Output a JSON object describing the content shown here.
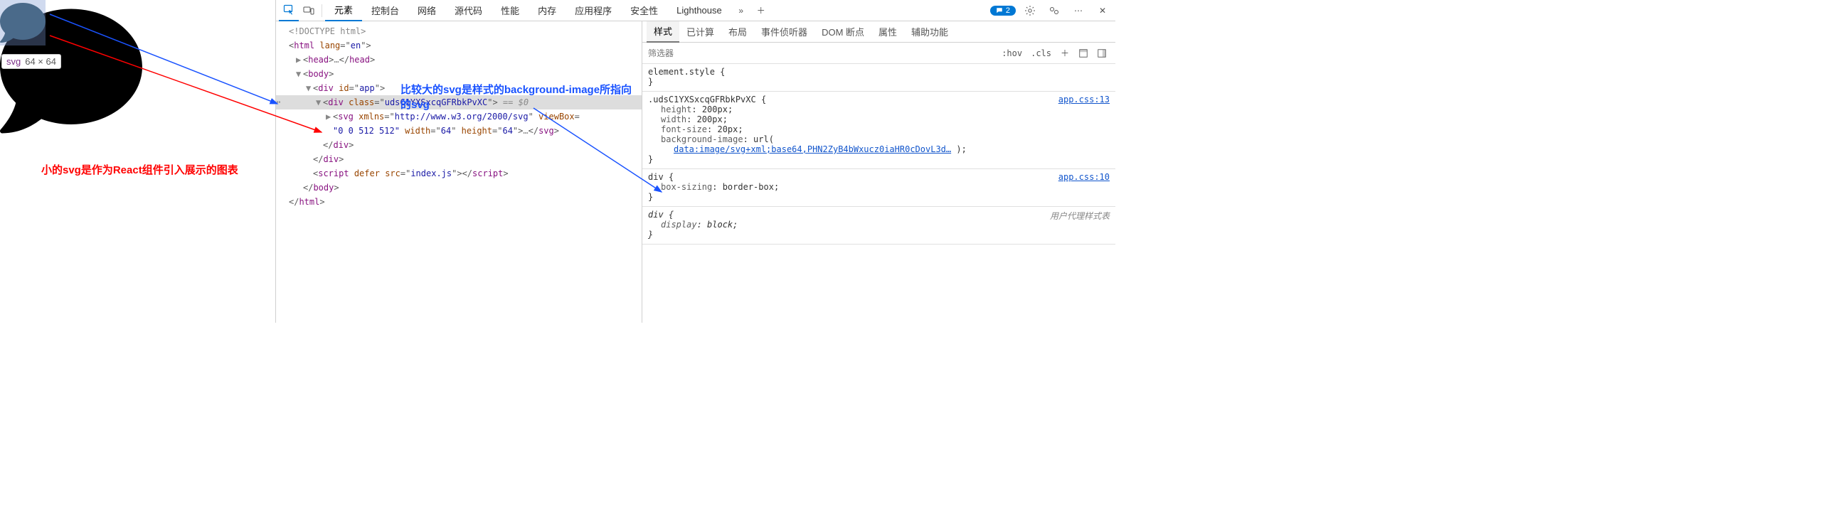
{
  "tooltip": {
    "tag": "svg",
    "dim": "64 × 64"
  },
  "annotations": {
    "red": "小的svg是作为React组件引入展示的图表",
    "blue": "比较大的svg是样式的background-image所指向的svg"
  },
  "topbar": {
    "tabs": [
      "元素",
      "控制台",
      "网络",
      "源代码",
      "性能",
      "内存",
      "应用程序",
      "安全性",
      "Lighthouse"
    ],
    "active": 0,
    "msg_count": "2"
  },
  "dom": {
    "l1": "<!DOCTYPE html>",
    "l2": {
      "tag": "html",
      "attrs": [
        [
          "lang",
          "en"
        ]
      ]
    },
    "l3": {
      "tag": "head",
      "ellipsis": true
    },
    "l4": {
      "tag": "body"
    },
    "l5": {
      "tag": "div",
      "attrs": [
        [
          "id",
          "app"
        ]
      ]
    },
    "l6": {
      "tag": "div",
      "attrs": [
        [
          "class",
          "udsC1YXSxcqGFRbkPvXC"
        ]
      ],
      "selected": true
    },
    "l7_pre": "<svg xmlns=\"",
    "l7_url": "http://www.w3.org/2000/svg",
    "l7_mid": "\" viewBox=",
    "l7b": "\"0 0 512 512\" width=\"64\" height=\"64\">…</svg>",
    "l8": "</div>",
    "l9": "</div>",
    "l10": {
      "tag": "script",
      "attrs": [
        [
          "defer",
          ""
        ],
        [
          "src",
          "index.js"
        ]
      ]
    },
    "l11": "</body>",
    "l12": "</html>",
    "eq0": "== $0"
  },
  "styles": {
    "tabs": [
      "样式",
      "已计算",
      "布局",
      "事件侦听器",
      "DOM 断点",
      "属性",
      "辅助功能"
    ],
    "active": 0,
    "filter_placeholder": "筛选器",
    "hov": ":hov",
    "cls": ".cls",
    "rules": [
      {
        "selector": "element.style",
        "props": []
      },
      {
        "selector": ".udsC1YXSxcqGFRbkPvXC",
        "link": "app.css:13",
        "props": [
          {
            "name": "height",
            "val": "200px"
          },
          {
            "name": "width",
            "val": "200px"
          },
          {
            "name": "font-size",
            "val": "20px"
          },
          {
            "name": "background-image",
            "val_raw": "url(",
            "data_url": "data:image/svg+xml;base64,PHN2ZyB4bWxucz0iaHR0cDovL3d…",
            "val_suffix": ");"
          }
        ]
      },
      {
        "selector": "div",
        "link": "app.css:10",
        "props": [
          {
            "name": "box-sizing",
            "val": "border-box"
          }
        ]
      },
      {
        "selector": "div",
        "src": "用户代理样式表",
        "italic": true,
        "props": [
          {
            "name": "display",
            "val": "block"
          }
        ]
      }
    ]
  }
}
